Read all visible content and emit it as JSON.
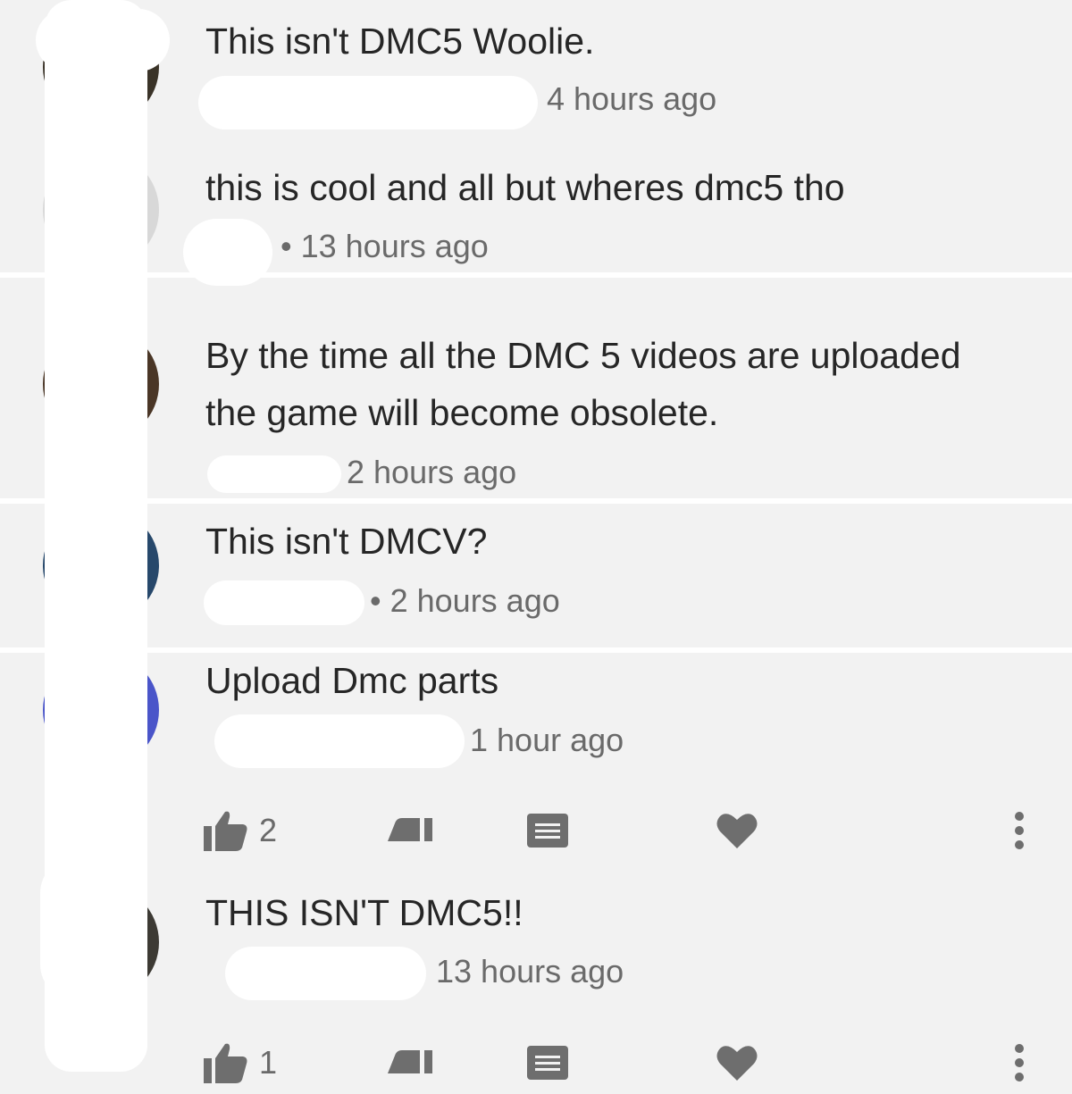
{
  "comments": [
    {
      "text": "This isn't DMC5 Woolie.",
      "time": "4 hours ago"
    },
    {
      "text": "this is cool and all but wheres dmc5 tho",
      "time": "• 13 hours ago"
    },
    {
      "text_line1": "By the time all the DMC 5 videos are uploaded",
      "text_line2": "the game will become obsolete.",
      "time": "2 hours ago"
    },
    {
      "text": "This isn't DMCV?",
      "time": "• 2 hours ago"
    },
    {
      "text": "Upload Dmc parts",
      "time": "1 hour ago",
      "likes": "2"
    },
    {
      "text": "THIS ISN'T DMC5!!",
      "time": "13 hours ago",
      "likes": "1"
    }
  ],
  "icons": [
    "thumbs-up-icon",
    "thumbs-down-icon",
    "reply-icon",
    "heart-icon",
    "more-icon"
  ],
  "colors": {
    "background": "#f2f2f2",
    "text": "#262626",
    "meta": "#6a6a6a",
    "icon": "#6e6e6e"
  }
}
